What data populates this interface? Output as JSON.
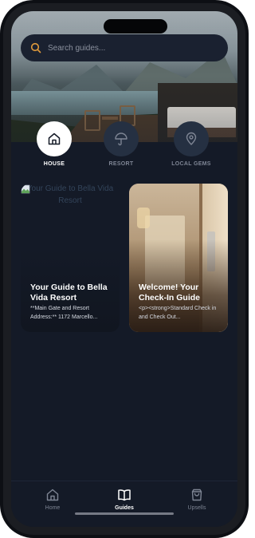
{
  "search": {
    "placeholder": "Search guides..."
  },
  "categories": [
    {
      "label": "HOUSE",
      "icon": "house-icon",
      "active": true
    },
    {
      "label": "RESORT",
      "icon": "umbrella-icon",
      "active": false
    },
    {
      "label": "LOCAL GEMS",
      "icon": "map-pin-icon",
      "active": false
    }
  ],
  "cards": [
    {
      "image_alt": "Your Guide to Bella Vida Resort",
      "title": "Your Guide to Bella Vida Resort",
      "desc": "**Main Gate and Resort Address:** 1172 Marcello..."
    },
    {
      "title": "Welcome! Your Check-In Guide",
      "desc": "<p><strong>Standard Check in and Check Out..."
    }
  ],
  "bottom_nav": [
    {
      "label": "Home",
      "icon": "home-icon",
      "active": false
    },
    {
      "label": "Guides",
      "icon": "book-open-icon",
      "active": true
    },
    {
      "label": "Upsells",
      "icon": "shopping-bag-icon",
      "active": false
    }
  ],
  "colors": {
    "background": "#141a27",
    "accent": "#e09a3c",
    "active_circle": "#ffffff",
    "inactive_circle": "#253042"
  }
}
